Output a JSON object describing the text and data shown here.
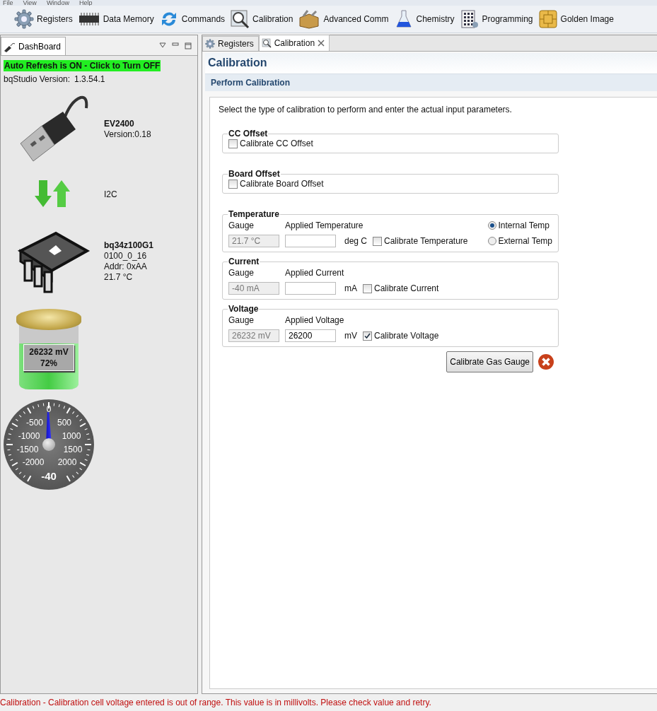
{
  "menu": [
    {
      "label": "File"
    },
    {
      "label": "View"
    },
    {
      "label": "Window"
    },
    {
      "label": "Help"
    }
  ],
  "toolbar": [
    {
      "label": "Registers",
      "kind": "gear"
    },
    {
      "label": "Data Memory",
      "kind": "chip"
    },
    {
      "label": "Commands",
      "kind": "arrows"
    },
    {
      "label": "Calibration",
      "kind": "magnifier"
    },
    {
      "label": "Advanced Comm",
      "kind": "toolbox"
    },
    {
      "label": "Chemistry",
      "kind": "flask"
    },
    {
      "label": "Programming",
      "kind": "grid"
    },
    {
      "label": "Golden Image",
      "kind": "card"
    }
  ],
  "dashboard": {
    "tab": "DashBoard",
    "auto_refresh": "Auto Refresh is ON - Click to Turn OFF",
    "version_label": "bqStudio Version:",
    "version": "1.3.54.1",
    "adapter": {
      "name": "EV2400",
      "version": "Version:0.18"
    },
    "bus": "I2C",
    "device": {
      "name": "bq34z100G1",
      "lines": [
        "0100_0_16",
        "Addr: 0xAA",
        "21.7 °C"
      ]
    },
    "battery": {
      "voltage": "26232 mV",
      "percent": "72%",
      "level": 0.72
    },
    "gauge": {
      "labels": [
        "0",
        "-500",
        "500",
        "-1000",
        "1000",
        "-1500",
        "1500",
        "-2000",
        "2000"
      ],
      "reading": "-40",
      "level": 0.496
    }
  },
  "editor_tabs": [
    {
      "label": "Registers",
      "kind": "gear",
      "selected": false,
      "closable": false
    },
    {
      "label": "Calibration",
      "kind": "magnifier",
      "selected": true,
      "closable": true
    }
  ],
  "calibration": {
    "title": "Calibration",
    "section": "Perform Calibration",
    "instructions": "Select the type of calibration to perform and enter the actual input parameters.",
    "groups": [
      {
        "kind": "checkbox",
        "title": "CC Offset",
        "checkbox": {
          "label": "Calibrate CC Offset",
          "checked": false
        }
      },
      {
        "kind": "checkbox",
        "title": "Board Offset",
        "checkbox": {
          "label": "Calibrate Board Offset",
          "checked": false
        }
      },
      {
        "kind": "measure",
        "title": "Temperature",
        "gauge_label": "Gauge",
        "applied_label": "Applied Temperature",
        "gauge_value": "21.7 °C",
        "unit": "deg C",
        "checkbox": {
          "label": "Calibrate Temperature",
          "checked": false
        },
        "radios": [
          {
            "label": "Internal Temp",
            "selected": true
          },
          {
            "label": "External Temp",
            "selected": false
          }
        ]
      },
      {
        "kind": "measure",
        "title": "Current",
        "gauge_label": "Gauge",
        "applied_label": "Applied Current",
        "gauge_value": "-40 mA",
        "unit": "mA",
        "checkbox": {
          "label": "Calibrate Current",
          "checked": false
        }
      },
      {
        "kind": "measure",
        "title": "Voltage",
        "gauge_label": "Gauge",
        "applied_label": "Applied Voltage",
        "gauge_value": "26232 mV",
        "applied_value": "26200",
        "unit": "mV",
        "checkbox": {
          "label": "Calibrate Voltage",
          "checked": true
        }
      }
    ],
    "button": "Calibrate Gas Gauge",
    "error": true
  },
  "status_bar": {
    "message": "Calibration - Calibration cell voltage entered is out of range. This value is in millivolts. Please check value and retry."
  }
}
